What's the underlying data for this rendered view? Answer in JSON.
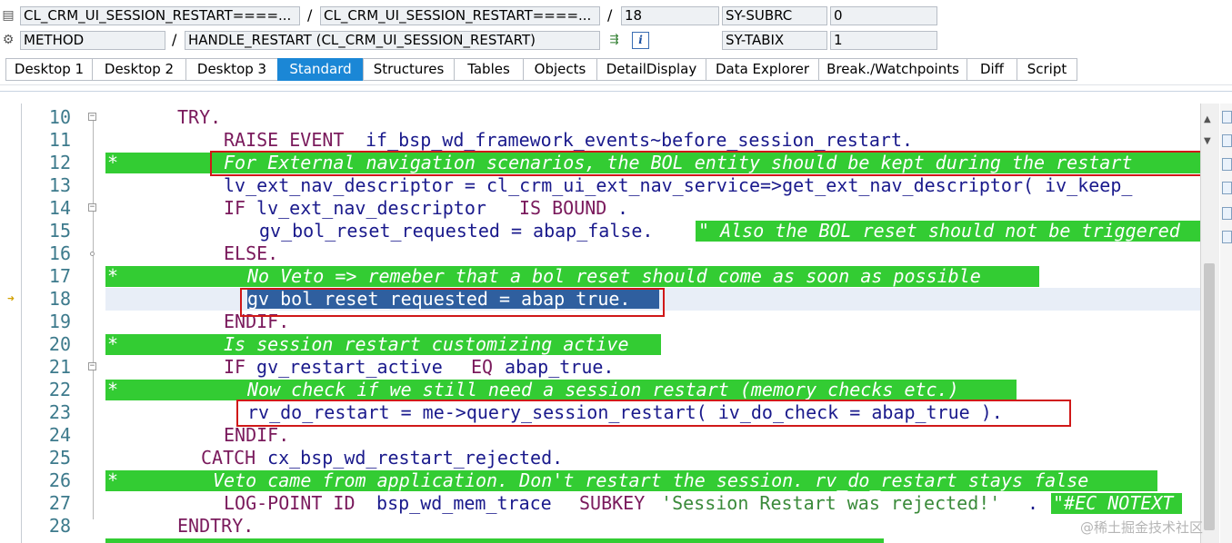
{
  "header": {
    "row1": {
      "program": "CL_CRM_UI_SESSION_RESTART====...",
      "include": "CL_CRM_UI_SESSION_RESTART====...",
      "line": "18",
      "sysfield1_name": "SY-SUBRC",
      "sysfield1_value": "0"
    },
    "row2": {
      "kind": "METHOD",
      "event": "HANDLE_RESTART (CL_CRM_UI_SESSION_RESTART)",
      "sysfield2_name": "SY-TABIX",
      "sysfield2_value": "1"
    },
    "separator": "/",
    "info_icon": "i"
  },
  "tabs": [
    {
      "label": "Desktop 1"
    },
    {
      "label": "Desktop 2"
    },
    {
      "label": "Desktop 3"
    },
    {
      "label": "Standard",
      "active": true
    },
    {
      "label": "Structures"
    },
    {
      "label": "Tables"
    },
    {
      "label": "Objects"
    },
    {
      "label": "DetailDisplay"
    },
    {
      "label": "Data Explorer"
    },
    {
      "label": "Break./Watchpoints"
    },
    {
      "label": "Diff"
    },
    {
      "label": "Script"
    }
  ],
  "code_lines": [
    {
      "num": "10",
      "text": "TRY."
    },
    {
      "num": "11",
      "text_a": "RAISE EVENT ",
      "text_b": "if_bsp_wd_framework_events~before_session_restart."
    },
    {
      "num": "12",
      "marker": "*",
      "comment": "For External navigation scenarios, the BOL entity should be kept during the restart"
    },
    {
      "num": "13",
      "text": "lv_ext_nav_descriptor = cl_crm_ui_ext_nav_service=>get_ext_nav_descriptor( iv_keep_"
    },
    {
      "num": "14",
      "kw1": "IF",
      "mid": " lv_ext_nav_descriptor ",
      "kw2": "IS BOUND",
      "end": "."
    },
    {
      "num": "15",
      "text": "gv_bol_reset_requested = abap_false.",
      "comment": "\" Also the BOL reset should not be triggered"
    },
    {
      "num": "16",
      "text": "ELSE."
    },
    {
      "num": "17",
      "marker": "*",
      "comment": "No Veto => remeber that a bol reset should come as soon as possible"
    },
    {
      "num": "18",
      "text": "gv_bol_reset_requested = abap_true."
    },
    {
      "num": "19",
      "text": "ENDIF."
    },
    {
      "num": "20",
      "marker": "*",
      "comment": "Is session restart customizing active"
    },
    {
      "num": "21",
      "kw1": "IF",
      "mid": " gv_restart_active ",
      "kw2": "EQ",
      "end": " abap_true."
    },
    {
      "num": "22",
      "marker": "*",
      "comment": "Now check if we still need a session restart (memory checks etc.)"
    },
    {
      "num": "23",
      "text": "rv_do_restart = me->query_session_restart( iv_do_check = abap_true )."
    },
    {
      "num": "24",
      "text": "ENDIF."
    },
    {
      "num": "25",
      "kw1": "CATCH",
      "mid": " cx_bsp_wd_restart_rejected."
    },
    {
      "num": "26",
      "marker": "*",
      "comment": "Veto came from application. Don't restart the session. rv_do_restart stays false"
    },
    {
      "num": "27",
      "kw1": "LOG-POINT ID",
      "mid": " bsp_wd_mem_trace ",
      "kw2": "SUBKEY",
      "str": " 'Session Restart was rejected!'",
      "end": ".",
      "comment": "\"#EC NOTEXT"
    },
    {
      "num": "28",
      "text": "ENDTRY."
    }
  ],
  "watermark": "@稀土掘金技术社区",
  "colors": {
    "comment_bg": "#33cc33",
    "active_tab": "#1b87d6",
    "highlight_box": "#d01818",
    "selection": "#2f5f9f"
  }
}
